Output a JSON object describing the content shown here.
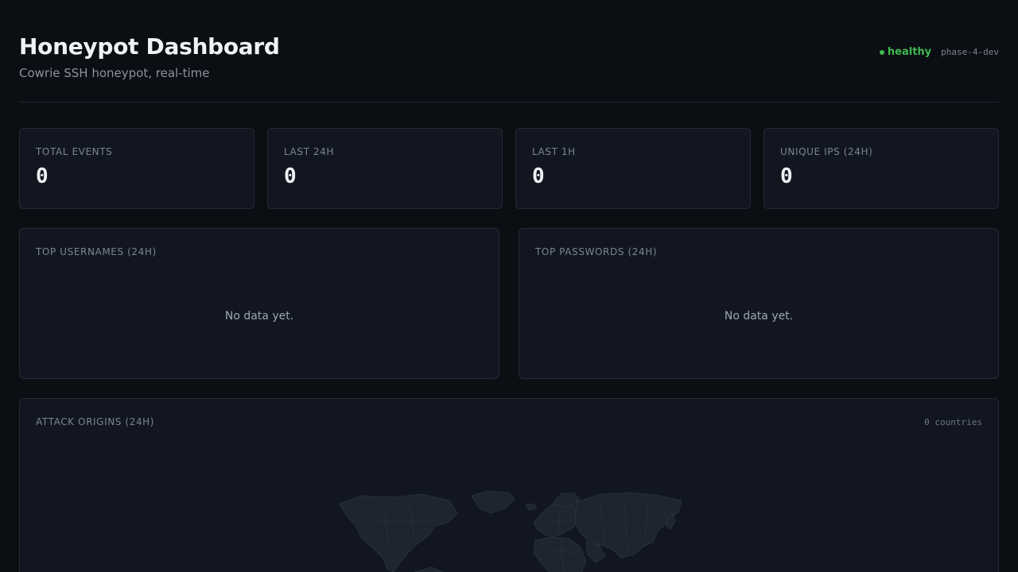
{
  "header": {
    "title": "Honeypot Dashboard",
    "subtitle": "Cowrie SSH honeypot, real-time",
    "status": "healthy",
    "status_color": "#3fb950",
    "env": "phase-4-dev"
  },
  "stats": [
    {
      "label": "TOTAL EVENTS",
      "value": "0"
    },
    {
      "label": "LAST 24H",
      "value": "0"
    },
    {
      "label": "LAST 1H",
      "value": "0"
    },
    {
      "label": "UNIQUE IPS (24H)",
      "value": "0"
    }
  ],
  "usernames": {
    "label": "TOP USERNAMES (24H)",
    "empty": "No data yet."
  },
  "passwords": {
    "label": "TOP PASSWORDS (24H)",
    "empty": "No data yet."
  },
  "origins": {
    "label": "ATTACK ORIGINS (24H)",
    "count": "0 countries"
  }
}
